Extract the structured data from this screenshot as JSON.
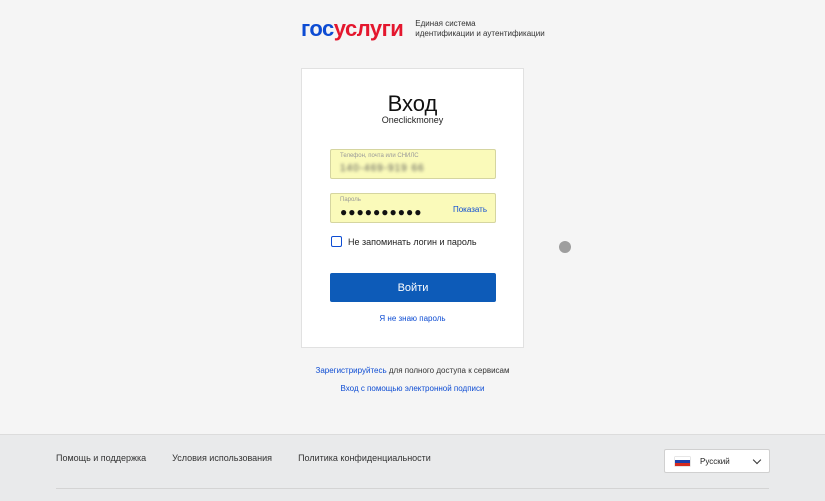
{
  "header": {
    "logo_part1": "гос",
    "logo_part2": "услуги",
    "subtitle_line1": "Единая система",
    "subtitle_line2": "идентификации и аутентификации"
  },
  "login": {
    "title": "Вход",
    "subtitle": "Oneclickmoney",
    "login_field": {
      "label": "Телефон, почта или СНИЛС",
      "value": "140-469-919 66"
    },
    "password_field": {
      "label": "Пароль",
      "value": "●●●●●●●●●●",
      "show_label": "Показать"
    },
    "remember_label": "Не запоминать логин и пароль",
    "remember_checked": false,
    "submit_label": "Войти",
    "forgot_label": "Я не знаю пароль"
  },
  "register": {
    "link": "Зарегистрируйтесь",
    "text": " для полного доступа к сервисам"
  },
  "esign_label": "Вход с помощью электронной подписи",
  "footer": {
    "links": [
      "Помощь и поддержка",
      "Условия использования",
      "Политика конфиденциальности"
    ],
    "language": "Русский"
  },
  "colors": {
    "brand_blue": "#0d4cd3",
    "brand_red": "#e4172e",
    "button": "#0d5bb8",
    "autofill": "#fafaba"
  },
  "icons": {
    "flag": "russia-flag-icon",
    "dropdown": "chevron-down-icon"
  }
}
